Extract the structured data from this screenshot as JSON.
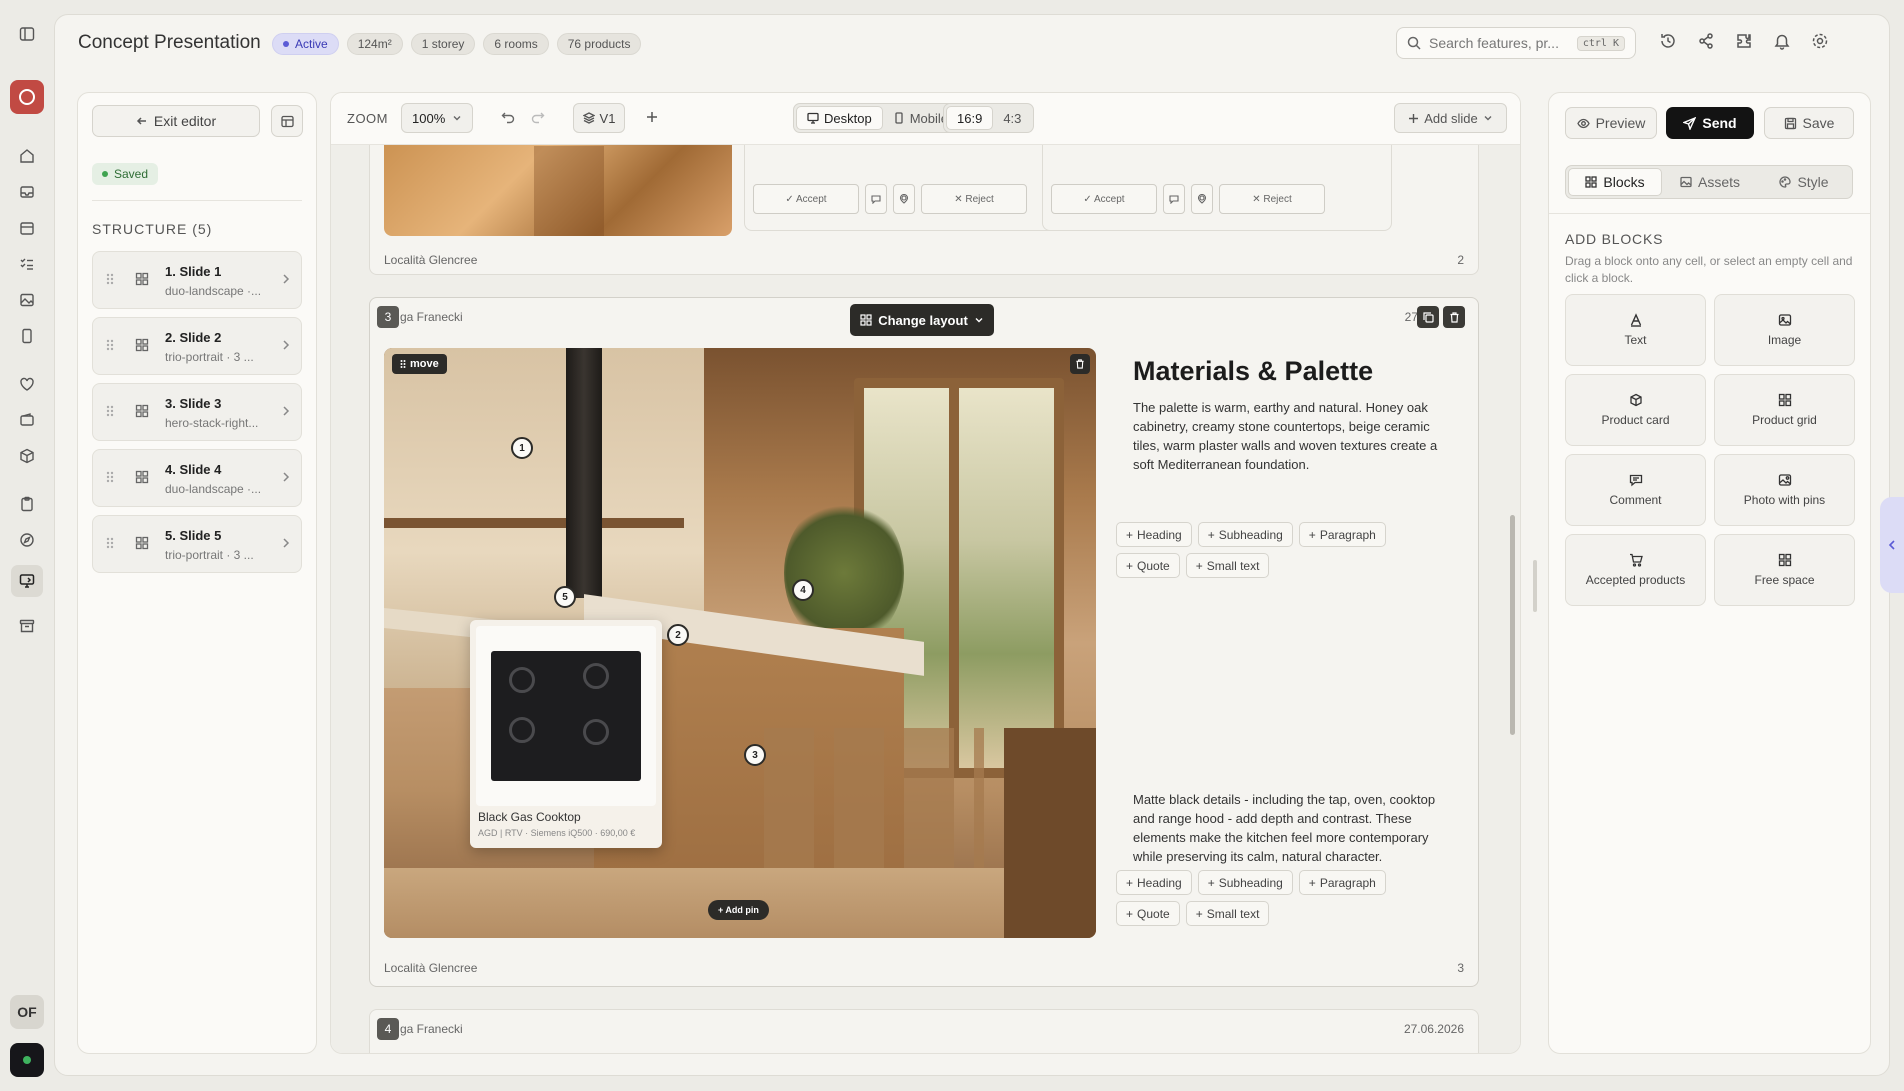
{
  "header": {
    "title": "Concept Presentation",
    "chips": [
      "Active",
      "124m²",
      "1 storey",
      "6 rooms",
      "76 products"
    ],
    "search_placeholder": "Search features, pr...",
    "search_kbd": "ctrl K"
  },
  "rail": {
    "initials": "OF"
  },
  "left_panel": {
    "exit_label": "Exit editor",
    "saved_label": "Saved",
    "structure_title": "STRUCTURE (5)",
    "slides": [
      {
        "name": "1. Slide 1",
        "layout": "duo-landscape ·..."
      },
      {
        "name": "2. Slide 2",
        "layout": "trio-portrait · 3 ..."
      },
      {
        "name": "3. Slide 3",
        "layout": "hero-stack-right..."
      },
      {
        "name": "4. Slide 4",
        "layout": "duo-landscape ·..."
      },
      {
        "name": "5. Slide 5",
        "layout": "trio-portrait · 3 ..."
      }
    ]
  },
  "canvas_toolbar": {
    "zoom_label": "ZOOM",
    "zoom_value": "100%",
    "version": "V1",
    "device_desktop": "Desktop",
    "device_mobile": "Mobile",
    "ratio_a": "16:9",
    "ratio_b": "4:3",
    "add_slide": "Add slide"
  },
  "slide2": {
    "accept": "✓ Accept",
    "reject": "✕ Reject",
    "footer": "Località Glencree",
    "number": "2"
  },
  "slide3": {
    "badge": "3",
    "author": "ga Franecki",
    "date": "27.0",
    "change_layout": "Change layout",
    "move_label": "move",
    "pins": [
      "1",
      "2",
      "3",
      "4",
      "5"
    ],
    "product": {
      "name": "Black Gas Cooktop",
      "meta": "AGD | RTV · Siemens iQ500 · 690,00 €"
    },
    "add_pin": "+ Add pin",
    "heading": "Materials & Palette",
    "paragraph1": "The palette is warm, earthy and natural. Honey oak cabinetry, creamy stone countertops, beige ceramic tiles, warm plaster walls and woven textures create a soft Mediterranean foundation.",
    "paragraph2": "Matte black details - including the tap, oven, cooktop and range hood - add depth and contrast. These elements make the kitchen feel more contemporary while preserving its calm, natural character.",
    "text_buttons": [
      "Heading",
      "Subheading",
      "Paragraph",
      "Quote",
      "Small text"
    ],
    "footer": "Località Glencree",
    "number": "3"
  },
  "slide4": {
    "badge": "4",
    "author": "ga Franecki",
    "date": "27.06.2026"
  },
  "right_panel": {
    "preview": "Preview",
    "send": "Send",
    "save": "Save",
    "tabs": [
      "Blocks",
      "Assets",
      "Style"
    ],
    "add_blocks_title": "ADD BLOCKS",
    "add_blocks_desc": "Drag a block onto any cell, or select an empty cell and click a block.",
    "blocks": [
      "Text",
      "Image",
      "Product card",
      "Product grid",
      "Comment",
      "Photo with pins",
      "Accepted products",
      "Free space"
    ]
  },
  "colors": {
    "accent": "#5b5bd6",
    "brand_red": "#c14a43",
    "dark": "#131313"
  }
}
